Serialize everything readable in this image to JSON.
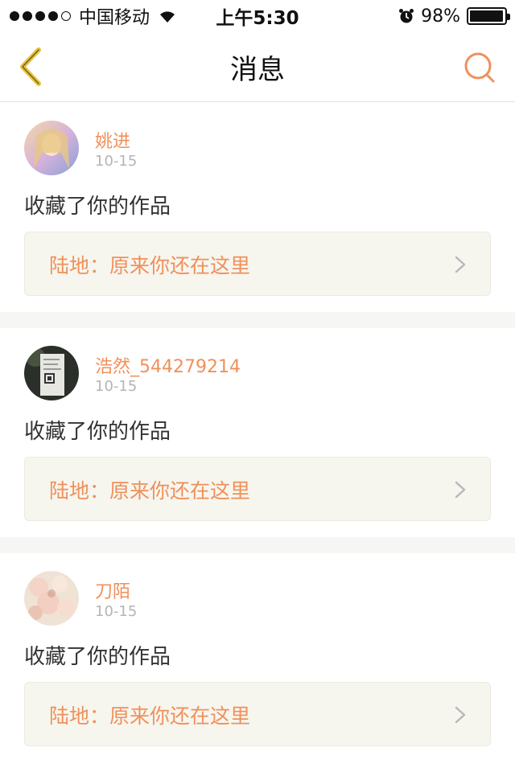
{
  "status_bar": {
    "carrier": "中国移动",
    "time": "上午5:30",
    "battery": "98%",
    "signal_bars_filled": 4,
    "battery_level": 0.98
  },
  "nav": {
    "title": "消息",
    "back_icon": "chevron-left-icon",
    "search_icon": "search-icon",
    "accent_color": "#f0905a",
    "back_color": "#e8c23a"
  },
  "messages": [
    {
      "username": "姚进",
      "date": "10-15",
      "action": "收藏了你的作品",
      "work_title": "陆地：原来你还在这里"
    },
    {
      "username": "浩然_544279214",
      "date": "10-15",
      "action": "收藏了你的作品",
      "work_title": "陆地：原来你还在这里"
    },
    {
      "username": "刀陌",
      "date": "10-15",
      "action": "收藏了你的作品",
      "work_title": "陆地：原来你还在这里"
    }
  ]
}
